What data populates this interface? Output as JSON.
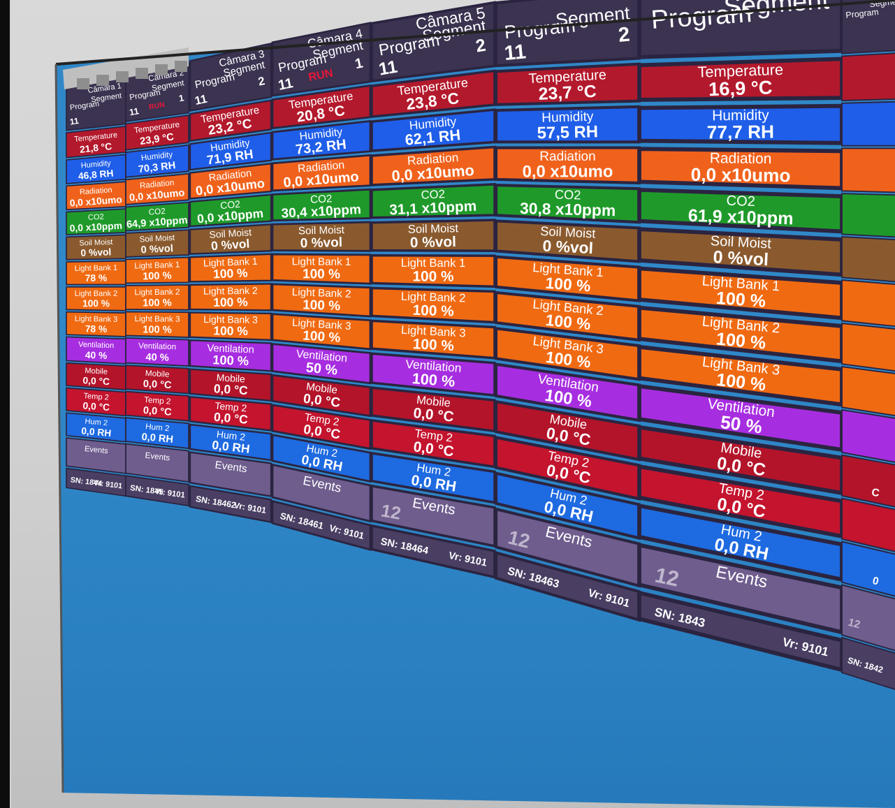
{
  "app": {
    "header_program_label": "Program",
    "header_segment_label": "Segment",
    "run_badge": "RUN"
  },
  "colors": {
    "temperature": "#b3192c",
    "humidity": "#1f5ee8",
    "radiation": "#f0621c",
    "co2": "#1f9a2a",
    "soil": "#8a5a2e",
    "light": "#f06a12",
    "ventilation": "#a72ee0",
    "mobile": "#b3142a",
    "temp2": "#c4142e",
    "hum2": "#1e6ae0",
    "events": "#6f5d8e",
    "header": "#3b3350",
    "desktop": "#2f86c7"
  },
  "chambers": [
    {
      "title": "Câmara 1",
      "program": "11",
      "segment": "",
      "cells": [
        {
          "label": "Temperature",
          "value": "21,8 °C"
        },
        {
          "label": "Humidity",
          "value": "46,8 RH"
        },
        {
          "label": "Radiation",
          "value": "0,0 x10umo"
        },
        {
          "label": "CO2",
          "value": "0,0 x10ppm"
        },
        {
          "label": "Soil Moist",
          "value": "0 %vol"
        },
        {
          "label": "Light Bank 1",
          "value": "78 %"
        },
        {
          "label": "Light Bank 2",
          "value": "100 %"
        },
        {
          "label": "Light Bank 3",
          "value": "78 %"
        },
        {
          "label": "Ventilation",
          "value": "40 %"
        },
        {
          "label": "Mobile",
          "value": "0,0 °C"
        },
        {
          "label": "Temp 2",
          "value": "0,0 °C"
        },
        {
          "label": "Hum 2",
          "value": "0,0 RH"
        },
        {
          "label": "Events",
          "value": ""
        }
      ],
      "sn": "SN: 1844",
      "vr": "Vr: 9101"
    },
    {
      "title": "Câmara 2",
      "program": "11",
      "segment": "1",
      "cells": [
        {
          "label": "Temperature",
          "value": "23,9 °C"
        },
        {
          "label": "Humidity",
          "value": "70,3 RH"
        },
        {
          "label": "Radiation",
          "value": "0,0 x10umo"
        },
        {
          "label": "CO2",
          "value": "64,9 x10ppm"
        },
        {
          "label": "Soil Moist",
          "value": "0 %vol"
        },
        {
          "label": "Light Bank 1",
          "value": "100 %"
        },
        {
          "label": "Light Bank 2",
          "value": "100 %"
        },
        {
          "label": "Light Bank 3",
          "value": "100 %"
        },
        {
          "label": "Ventilation",
          "value": "40 %"
        },
        {
          "label": "Mobile",
          "value": "0,0 °C"
        },
        {
          "label": "Temp 2",
          "value": "0,0 °C"
        },
        {
          "label": "Hum 2",
          "value": "0,0 RH"
        },
        {
          "label": "Events",
          "value": ""
        }
      ],
      "sn": "SN: 1845",
      "vr": "Vr: 9101"
    },
    {
      "title": "Câmara 3",
      "program": "11",
      "segment": "2",
      "cells": [
        {
          "label": "Temperature",
          "value": "23,2 °C"
        },
        {
          "label": "Humidity",
          "value": "71,9 RH"
        },
        {
          "label": "Radiation",
          "value": "0,0 x10umo"
        },
        {
          "label": "CO2",
          "value": "0,0 x10ppm"
        },
        {
          "label": "Soil Moist",
          "value": "0 %vol"
        },
        {
          "label": "Light Bank 1",
          "value": "100 %"
        },
        {
          "label": "Light Bank 2",
          "value": "100 %"
        },
        {
          "label": "Light Bank 3",
          "value": "100 %"
        },
        {
          "label": "Ventilation",
          "value": "100 %"
        },
        {
          "label": "Mobile",
          "value": "0,0 °C"
        },
        {
          "label": "Temp 2",
          "value": "0,0 °C"
        },
        {
          "label": "Hum 2",
          "value": "0,0 RH"
        },
        {
          "label": "Events",
          "value": ""
        }
      ],
      "sn": "SN: 18462",
      "vr": "Vr: 9101"
    },
    {
      "title": "Câmara 4",
      "program": "11",
      "segment": "1",
      "cells": [
        {
          "label": "Temperature",
          "value": "20,8 °C"
        },
        {
          "label": "Humidity",
          "value": "73,2 RH"
        },
        {
          "label": "Radiation",
          "value": "0,0 x10umo"
        },
        {
          "label": "CO2",
          "value": "30,4 x10ppm"
        },
        {
          "label": "Soil Moist",
          "value": "0 %vol"
        },
        {
          "label": "Light Bank 1",
          "value": "100 %"
        },
        {
          "label": "Light Bank 2",
          "value": "100 %"
        },
        {
          "label": "Light Bank 3",
          "value": "100 %"
        },
        {
          "label": "Ventilation",
          "value": "50 %"
        },
        {
          "label": "Mobile",
          "value": "0,0 °C"
        },
        {
          "label": "Temp 2",
          "value": "0,0 °C"
        },
        {
          "label": "Hum 2",
          "value": "0,0 RH"
        },
        {
          "label": "Events",
          "value": ""
        }
      ],
      "sn": "SN: 18461",
      "vr": "Vr: 9101"
    },
    {
      "title": "Câmara 5",
      "program": "11",
      "segment": "2",
      "cells": [
        {
          "label": "Temperature",
          "value": "23,8 °C"
        },
        {
          "label": "Humidity",
          "value": "62,1 RH"
        },
        {
          "label": "Radiation",
          "value": "0,0 x10umo"
        },
        {
          "label": "CO2",
          "value": "31,1 x10ppm"
        },
        {
          "label": "Soil Moist",
          "value": "0 %vol"
        },
        {
          "label": "Light Bank 1",
          "value": "100 %"
        },
        {
          "label": "Light Bank 2",
          "value": "100 %"
        },
        {
          "label": "Light Bank 3",
          "value": "100 %"
        },
        {
          "label": "Ventilation",
          "value": "100 %"
        },
        {
          "label": "Mobile",
          "value": "0,0 °C"
        },
        {
          "label": "Temp 2",
          "value": "0,0 °C"
        },
        {
          "label": "Hum 2",
          "value": "0,0 RH"
        },
        {
          "label": "Events",
          "value": "12"
        }
      ],
      "sn": "SN: 18464",
      "vr": "Vr: 9101"
    },
    {
      "title": "",
      "program": "11",
      "segment": "2",
      "cells": [
        {
          "label": "Temperature",
          "value": "23,7 °C"
        },
        {
          "label": "Humidity",
          "value": "57,5 RH"
        },
        {
          "label": "Radiation",
          "value": "0,0 x10umo"
        },
        {
          "label": "CO2",
          "value": "30,8 x10ppm"
        },
        {
          "label": "Soil Moist",
          "value": "0 %vol"
        },
        {
          "label": "Light Bank 1",
          "value": "100 %"
        },
        {
          "label": "Light Bank 2",
          "value": "100 %"
        },
        {
          "label": "Light Bank 3",
          "value": "100 %"
        },
        {
          "label": "Ventilation",
          "value": "100 %"
        },
        {
          "label": "Mobile",
          "value": "0,0 °C"
        },
        {
          "label": "Temp 2",
          "value": "0,0 °C"
        },
        {
          "label": "Hum 2",
          "value": "0,0 RH"
        },
        {
          "label": "Events",
          "value": "12"
        }
      ],
      "sn": "SN: 18463",
      "vr": "Vr: 9101"
    },
    {
      "title": "",
      "program": "",
      "segment": "",
      "cells": [
        {
          "label": "Temperature",
          "value": "16,9 °C"
        },
        {
          "label": "Humidity",
          "value": "77,7 RH"
        },
        {
          "label": "Radiation",
          "value": "0,0 x10umo"
        },
        {
          "label": "CO2",
          "value": "61,9 x10ppm"
        },
        {
          "label": "Soil Moist",
          "value": "0 %vol"
        },
        {
          "label": "Light Bank 1",
          "value": "100 %"
        },
        {
          "label": "Light Bank 2",
          "value": "100 %"
        },
        {
          "label": "Light Bank 3",
          "value": "100 %"
        },
        {
          "label": "Ventilation",
          "value": "50 %"
        },
        {
          "label": "Mobile",
          "value": "0,0 °C"
        },
        {
          "label": "Temp 2",
          "value": "0,0 °C"
        },
        {
          "label": "Hum 2",
          "value": "0,0 RH"
        },
        {
          "label": "Events",
          "value": "12"
        }
      ],
      "sn": "SN: 1843",
      "vr": "Vr: 9101"
    },
    {
      "title": "",
      "program": "",
      "segment": "",
      "cells": [
        {
          "label": "",
          "value": ""
        },
        {
          "label": "",
          "value": ""
        },
        {
          "label": "",
          "value": ""
        },
        {
          "label": "",
          "value": ""
        },
        {
          "label": "",
          "value": ""
        },
        {
          "label": "",
          "value": ""
        },
        {
          "label": "",
          "value": ""
        },
        {
          "label": "",
          "value": ""
        },
        {
          "label": "",
          "value": ""
        },
        {
          "label": "",
          "value": "C"
        },
        {
          "label": "",
          "value": ""
        },
        {
          "label": "",
          "value": "0"
        },
        {
          "label": "",
          "value": "12"
        }
      ],
      "sn": "SN: 1842",
      "vr": ""
    }
  ],
  "cell_kinds": [
    "temperature",
    "humidity",
    "radiation",
    "co2",
    "soil",
    "light",
    "light",
    "light",
    "ventilation",
    "mobile",
    "temp2",
    "hum2",
    "events"
  ]
}
